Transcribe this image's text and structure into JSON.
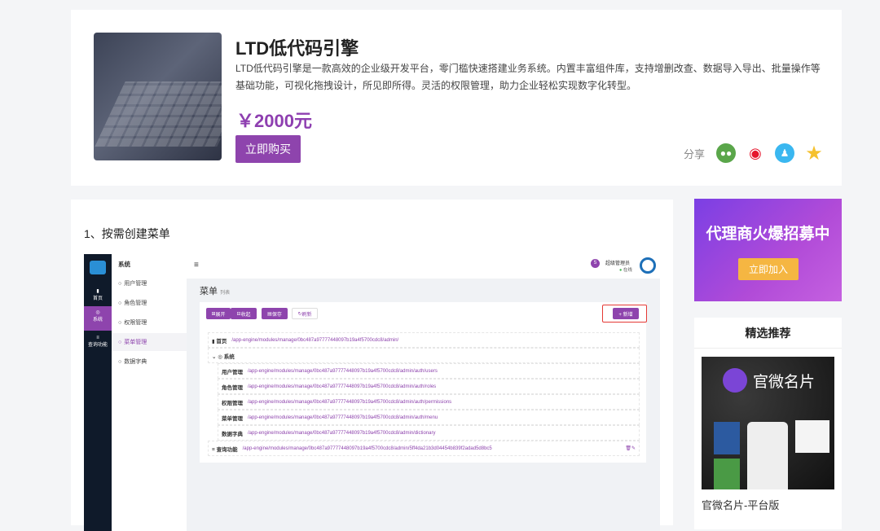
{
  "product": {
    "title": "LTD低代码引擎",
    "description": "LTD低代码引擎是一款高效的企业级开发平台，零门槛快速搭建业务系统。内置丰富组件库，支持增删改查、数据导入导出、批量操作等基础功能，可视化拖拽设计，所见即所得。灵活的权限管理，助力企业轻松实现数字化转型。",
    "price": "￥2000元",
    "buy_label": "立即购买",
    "share_label": "分享",
    "share_icons": [
      "wechat-icon",
      "weibo-icon",
      "qq-icon",
      "qzone-icon"
    ]
  },
  "article": {
    "step": "1、按需创建菜单"
  },
  "app": {
    "nav1": [
      {
        "label": "首页"
      },
      {
        "label": "系统"
      },
      {
        "label": "查询功能"
      }
    ],
    "nav2_title": "系统",
    "nav2": [
      "用户管理",
      "角色管理",
      "权限管理",
      "菜单管理",
      "数据字典"
    ],
    "user": {
      "name": "超级管理员",
      "status": "在线",
      "badge": "5"
    },
    "page_title": "菜单",
    "page_sub": "列表",
    "buttons": {
      "expand": "展开",
      "collapse": "收起",
      "save": "保存",
      "refresh": "刷新",
      "add": "+ 新增"
    },
    "rows": [
      {
        "name": "首页",
        "path": "/app-engine/modules/manage/0bc487a97777448097b19a4f5700cdc8/admin/"
      },
      {
        "name": "系统",
        "path": ""
      },
      {
        "name": "用户管理",
        "path": "/app-engine/modules/manage/0bc487a97777448097b19a4f5700cdc8/admin/auth/users"
      },
      {
        "name": "角色管理",
        "path": "/app-engine/modules/manage/0bc487a97777448097b19a4f5700cdc8/admin/auth/roles"
      },
      {
        "name": "权限管理",
        "path": "/app-engine/modules/manage/0bc487a97777448097b19a4f5700cdc8/admin/auth/permissions"
      },
      {
        "name": "菜单管理",
        "path": "/app-engine/modules/manage/0bc487a97777448097b19a4f5700cdc8/admin/auth/menu"
      },
      {
        "name": "数据字典",
        "path": "/app-engine/modules/manage/0bc487a97777448097b19a4f5700cdc8/admin/dictionary"
      },
      {
        "name": "查询功能",
        "path": "/app-engine/modules/manage/0bc487a97777448097b19a4f5700cdc8/admin/5ff4da21b3d04454b839f2adad5d8bc5"
      }
    ]
  },
  "banner": {
    "title": "代理商火爆招募中",
    "button": "立即加入"
  },
  "recommend": {
    "heading": "精选推荐",
    "image_text": "官微名片",
    "caption": "官微名片-平台版"
  },
  "colors": {
    "accent": "#8e44ad",
    "bg": "#f4f5f7"
  }
}
